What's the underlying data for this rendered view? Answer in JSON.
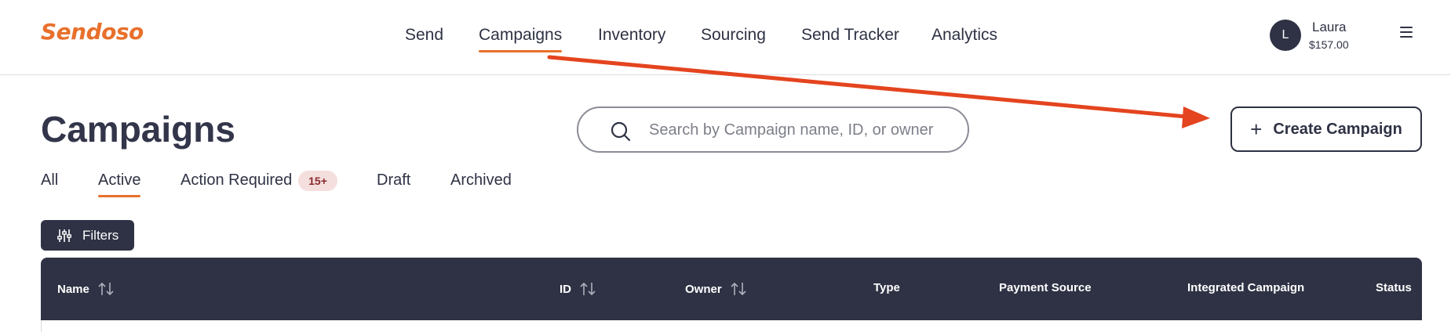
{
  "brand": {
    "logo_text": "Sendoso",
    "accent": "#e8702b",
    "dark": "#2e3244"
  },
  "nav": {
    "items": [
      {
        "label": "Send",
        "active": false
      },
      {
        "label": "Campaigns",
        "active": true
      },
      {
        "label": "Inventory",
        "active": false
      },
      {
        "label": "Sourcing",
        "active": false
      },
      {
        "label": "Send Tracker",
        "active": false
      },
      {
        "label": "Analytics",
        "active": false
      }
    ],
    "menu_icon": "hamburger-icon"
  },
  "user": {
    "initial": "L",
    "name": "Laura",
    "balance": "$157.00"
  },
  "page": {
    "title": "Campaigns"
  },
  "search": {
    "placeholder": "Search by Campaign name, ID, or owner",
    "value": "",
    "icon": "search-icon"
  },
  "create_button": {
    "label": "Create Campaign",
    "icon": "plus-icon"
  },
  "tabs": [
    {
      "label": "All",
      "active": false
    },
    {
      "label": "Active",
      "active": true
    },
    {
      "label": "Action Required",
      "active": false,
      "badge": "15+"
    },
    {
      "label": "Draft",
      "active": false
    },
    {
      "label": "Archived",
      "active": false
    }
  ],
  "filters": {
    "label": "Filters",
    "icon": "sliders-icon"
  },
  "table": {
    "columns": [
      {
        "label": "Name",
        "sortable": true
      },
      {
        "label": "ID",
        "sortable": true
      },
      {
        "label": "Owner",
        "sortable": true
      },
      {
        "label": "Type",
        "sortable": false
      },
      {
        "label": "Payment Source",
        "sortable": false
      },
      {
        "label": "Integrated Campaign",
        "sortable": false
      },
      {
        "label": "Status",
        "sortable": false
      }
    ]
  },
  "annotation": {
    "arrow_color": "#e4441f"
  }
}
